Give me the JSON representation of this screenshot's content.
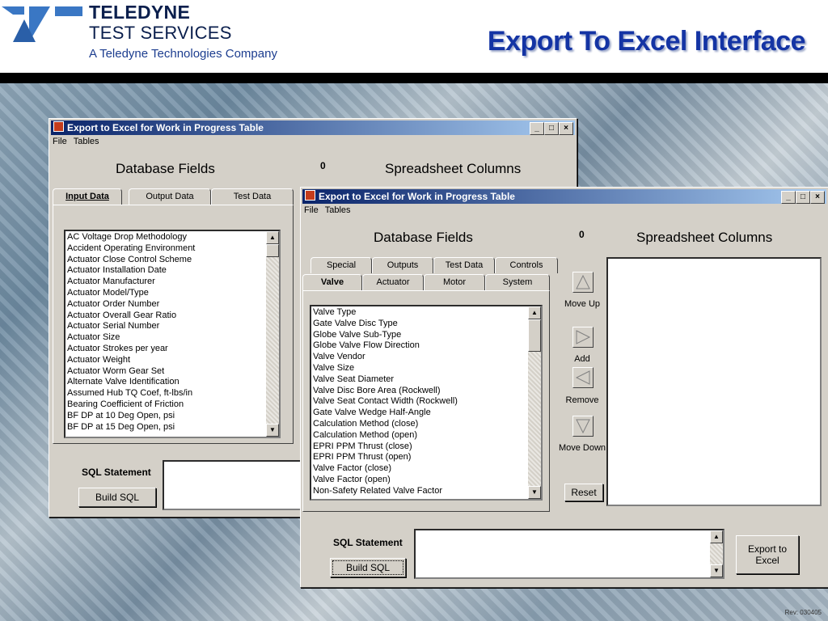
{
  "slide": {
    "brand_line1": "TELEDYNE",
    "brand_line2": "TEST SERVICES",
    "brand_line3": "A Teledyne Technologies Company",
    "title": "Export To Excel Interface",
    "footer": "Rev: 030405",
    "colors": {
      "title": "#1434a4",
      "brand": "#0b1f4d",
      "titlebar": "#0a246a"
    }
  },
  "back_window": {
    "title": "Export to Excel for Work in Progress Table",
    "menu": [
      "File",
      "Tables"
    ],
    "db_header": "Database Fields",
    "counter": "0",
    "ss_header": "Spreadsheet Columns",
    "tabs": [
      "Input Data",
      "Output Data",
      "Test Data"
    ],
    "active_tab": "Input Data",
    "fields": [
      "AC Voltage Drop Methodology",
      "Accident Operating Environment",
      "Actuator Close Control Scheme",
      "Actuator Installation Date",
      "Actuator Manufacturer",
      "Actuator Model/Type",
      "Actuator Order Number",
      "Actuator Overall Gear Ratio",
      "Actuator Serial Number",
      "Actuator Size",
      "Actuator Strokes per year",
      "Actuator Weight",
      "Actuator Worm Gear Set",
      "Alternate Valve Identification",
      "Assumed Hub TQ Coef, ft-lbs/in",
      "Bearing Coefficient of Friction",
      "BF DP at 10 Deg Open, psi",
      "BF DP at 15 Deg Open, psi"
    ],
    "sql_label": "SQL Statement",
    "build_sql": "Build SQL"
  },
  "front_window": {
    "title": "Export to Excel for Work in Progress Table",
    "menu": [
      "File",
      "Tables"
    ],
    "db_header": "Database Fields",
    "counter": "0",
    "ss_header": "Spreadsheet Columns",
    "tabs_row1": [
      "Special",
      "Outputs",
      "Test Data",
      "Controls"
    ],
    "tabs_row2": [
      "Valve",
      "Actuator",
      "Motor",
      "System"
    ],
    "active_tab": "Valve",
    "fields": [
      "Valve Type",
      "Gate Valve Disc Type",
      "Globe Valve Sub-Type",
      "Globe Valve Flow Direction",
      "Valve Vendor",
      "Valve Size",
      "Valve Seat Diameter",
      "Valve Disc Bore Area (Rockwell)",
      "Valve Seat Contact Width (Rockwell)",
      "Gate Valve Wedge Half-Angle",
      "Calculation Method (close)",
      "Calculation Method (open)",
      "EPRI PPM Thrust (close)",
      "EPRI PPM Thrust (open)",
      "Valve Factor (close)",
      "Valve Factor (open)",
      "Non-Safety Related Valve Factor"
    ],
    "move_up": "Move Up",
    "add": "Add",
    "remove": "Remove",
    "move_down": "Move Down",
    "reset": "Reset",
    "sql_label": "SQL Statement",
    "build_sql": "Build SQL",
    "export": "Export to Excel"
  }
}
